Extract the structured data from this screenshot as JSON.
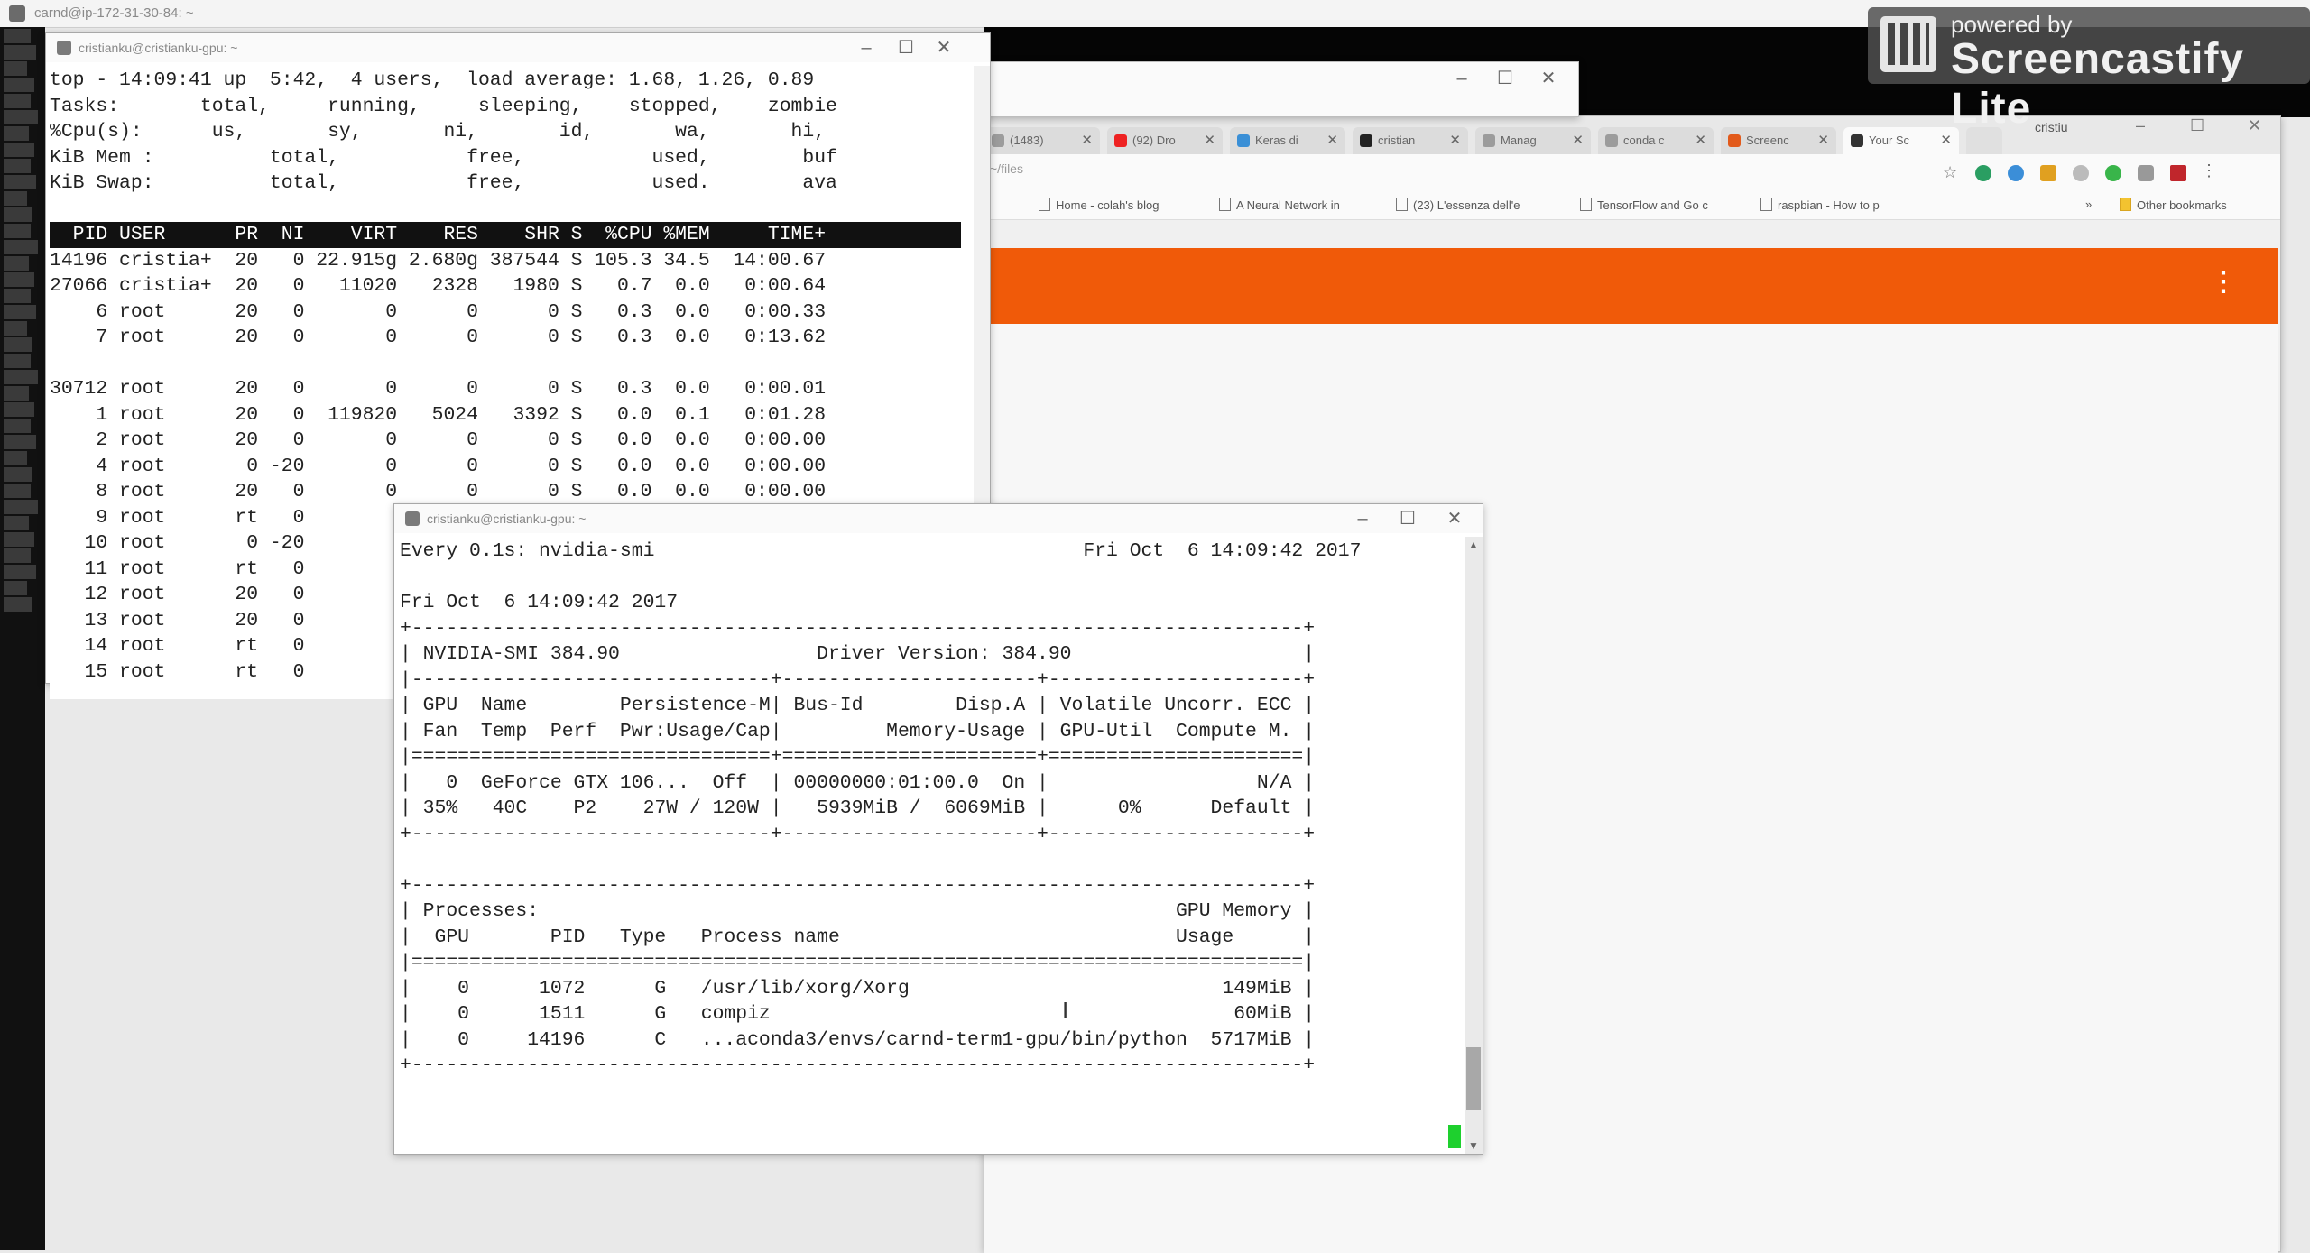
{
  "top_strip": {
    "title": "carnd@ip-172-31-30-84: ~"
  },
  "watermark": {
    "line1": "powered by",
    "line2": "Screencastify Lite"
  },
  "browser": {
    "tabs": [
      {
        "label": "(1483)"
      },
      {
        "label": "(92) Dro"
      },
      {
        "label": "Keras di"
      },
      {
        "label": "cristian"
      },
      {
        "label": "Manag"
      },
      {
        "label": "conda c"
      },
      {
        "label": "Screenc"
      },
      {
        "label": "Your Sc"
      }
    ],
    "profile": "cristiu",
    "url": "~/files",
    "bookmarks": [
      "Home - colah's blog",
      "A Neural Network in",
      "(23) L'essenza dell'e",
      "TensorFlow and Go c",
      "raspbian - How to p"
    ],
    "other_bookmarks": "Other bookmarks",
    "menu_dots": "⋮"
  },
  "top_terminal": {
    "title": "cristianku@cristianku-gpu: ~",
    "lines": [
      "top - 14:09:41 up  5:42,  4 users,  load average: 1.68, 1.26, 0.89",
      "Tasks:       total,     running,     sleeping,    stopped,    zombie",
      "%Cpu(s):      us,       sy,       ni,       id,       wa,       hi,",
      "KiB Mem :          total,           free,           used,        buf",
      "KiB Swap:          total,           free,           used.        ava"
    ],
    "header": "  PID USER      PR  NI    VIRT    RES    SHR S  %CPU %MEM     TIME+ ",
    "rows": [
      "14196 cristia+  20   0 22.915g 2.680g 387544 S 105.3 34.5  14:00.67",
      "27066 cristia+  20   0   11020   2328   1980 S   0.7  0.0   0:00.64",
      "    6 root      20   0       0      0      0 S   0.3  0.0   0:00.33",
      "    7 root      20   0       0      0      0 S   0.3  0.0   0:13.62",
      "",
      "30712 root      20   0       0      0      0 S   0.3  0.0   0:00.01",
      "    1 root      20   0  119820   5024   3392 S   0.0  0.1   0:01.28",
      "    2 root      20   0       0      0      0 S   0.0  0.0   0:00.00",
      "    4 root       0 -20       0      0      0 S   0.0  0.0   0:00.00",
      "    8 root      20   0       0      0      0 S   0.0  0.0   0:00.00",
      "    9 root      rt   0",
      "   10 root       0 -20",
      "   11 root      rt   0",
      "   12 root      20   0",
      "   13 root      20   0",
      "   14 root      rt   0",
      "   15 root      rt   0"
    ]
  },
  "smi_terminal": {
    "title": "cristianku@cristianku-gpu: ~",
    "lines": [
      "Every 0.1s: nvidia-smi                                     Fri Oct  6 14:09:42 2017",
      "",
      "Fri Oct  6 14:09:42 2017",
      "+-----------------------------------------------------------------------------+",
      "| NVIDIA-SMI 384.90                 Driver Version: 384.90                    |",
      "|-------------------------------+----------------------+----------------------+",
      "| GPU  Name        Persistence-M| Bus-Id        Disp.A | Volatile Uncorr. ECC |",
      "| Fan  Temp  Perf  Pwr:Usage/Cap|         Memory-Usage | GPU-Util  Compute M. |",
      "|===============================+======================+======================|",
      "|   0  GeForce GTX 106...  Off  | 00000000:01:00.0  On |                  N/A |",
      "| 35%   40C    P2    27W / 120W |   5939MiB /  6069MiB |      0%      Default |",
      "+-------------------------------+----------------------+----------------------+",
      "",
      "+-----------------------------------------------------------------------------+",
      "| Processes:                                                       GPU Memory |",
      "|  GPU       PID   Type   Process name                             Usage      |",
      "|=============================================================================|",
      "|    0      1072      G   /usr/lib/xorg/Xorg                           149MiB |",
      "|    0      1511      G   compiz                                        60MiB |",
      "|    0     14196      C   ...aconda3/envs/carnd-term1-gpu/bin/python  5717MiB |",
      "+-----------------------------------------------------------------------------+"
    ]
  },
  "window_controls": {
    "minimize": "–",
    "maximize": "☐",
    "close": "✕"
  }
}
